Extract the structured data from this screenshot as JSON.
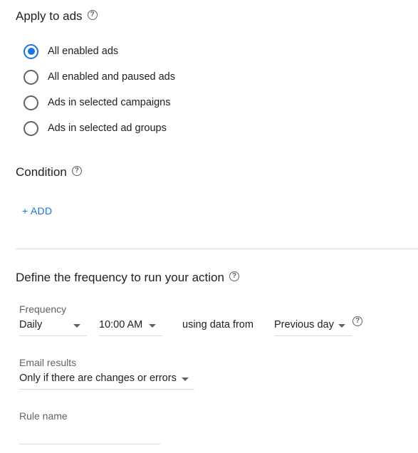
{
  "apply_section": {
    "title": "Apply to ads",
    "help_icon": "?",
    "options": [
      {
        "label": "All enabled ads",
        "selected": true
      },
      {
        "label": "All enabled and paused ads",
        "selected": false
      },
      {
        "label": "Ads in selected campaigns",
        "selected": false
      },
      {
        "label": "Ads in selected ad groups",
        "selected": false
      }
    ]
  },
  "condition_section": {
    "title": "Condition",
    "help_icon": "?",
    "add_label": "+ ADD"
  },
  "frequency_section": {
    "title": "Define the frequency to run your action",
    "help_icon": "?",
    "frequency_label": "Frequency",
    "frequency_value": "Daily",
    "time_value": "10:00 AM",
    "using_data_text": "using data from",
    "data_range_value": "Previous day",
    "data_help_icon": "?"
  },
  "email_section": {
    "label": "Email results",
    "value": "Only if there are changes or errors"
  },
  "rule_name": {
    "label": "Rule name",
    "value": ""
  },
  "colors": {
    "accent": "#1a73e8",
    "text": "#202124",
    "secondary_text": "#5f6368",
    "divider": "#dadce0"
  }
}
